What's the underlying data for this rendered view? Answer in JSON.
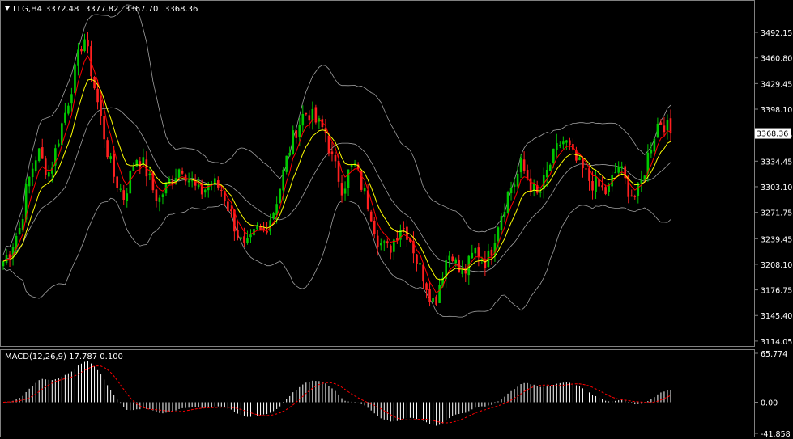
{
  "main_chart": {
    "symbol_label": "LLG,H4",
    "ohlc": [
      "3372.48",
      "3377.82",
      "3367.70",
      "3368.36"
    ],
    "current_price": "3368.36",
    "price_range": [
      3110,
      3510
    ],
    "price_ticks": [
      "3492.15",
      "3460.80",
      "3429.45",
      "3398.10",
      "3366.75",
      "3334.45",
      "3303.10",
      "3271.75",
      "3239.45",
      "3208.10",
      "3176.75",
      "3145.40",
      "3114.05"
    ],
    "price_tick_values": [
      3492.15,
      3460.8,
      3429.45,
      3398.1,
      3366.75,
      3334.45,
      3303.1,
      3271.75,
      3239.45,
      3208.1,
      3176.75,
      3145.4,
      3114.05
    ],
    "colors": {
      "bull": "#00c800",
      "bear": "#ff2020",
      "ma_fast": "#ff0000",
      "ma_slow": "#ffff00",
      "bands": "#a0a0a0",
      "text": "#ffffff",
      "grid_border": "#808080"
    },
    "close_path": [
      3212,
      3222,
      3240,
      3255,
      3300,
      3325,
      3348,
      3330,
      3320,
      3345,
      3375,
      3400,
      3430,
      3460,
      3490,
      3455,
      3420,
      3385,
      3350,
      3320,
      3305,
      3290,
      3315,
      3340,
      3335,
      3320,
      3300,
      3285,
      3300,
      3310,
      3320,
      3330,
      3315,
      3305,
      3295,
      3300,
      3310,
      3305,
      3300,
      3280,
      3260,
      3240,
      3225,
      3235,
      3250,
      3245,
      3260,
      3275,
      3300,
      3330,
      3355,
      3375,
      3390,
      3395,
      3385,
      3378,
      3370,
      3340,
      3320,
      3300,
      3320,
      3330,
      3310,
      3290,
      3270,
      3240,
      3230,
      3225,
      3240,
      3255,
      3250,
      3235,
      3210,
      3195,
      3175,
      3160,
      3190,
      3215,
      3225,
      3200,
      3195,
      3210,
      3225,
      3220,
      3210,
      3230,
      3260,
      3280,
      3300,
      3310,
      3330,
      3315,
      3300,
      3290,
      3310,
      3330,
      3345,
      3360,
      3355,
      3340,
      3330,
      3320,
      3310,
      3305,
      3300,
      3295,
      3315,
      3330,
      3310,
      3295,
      3290,
      3310,
      3340,
      3365,
      3385,
      3380,
      3368
    ]
  },
  "macd": {
    "label": "MACD(12,26,9) 17.787 0.100",
    "range": [
      -41.858,
      65.774
    ],
    "ticks": [
      "65.774",
      "0.00",
      "-41.858"
    ],
    "tick_values": [
      65.774,
      0.0,
      -41.858
    ],
    "histogram_color": "#ffffff",
    "signal_color": "#ff0000"
  }
}
